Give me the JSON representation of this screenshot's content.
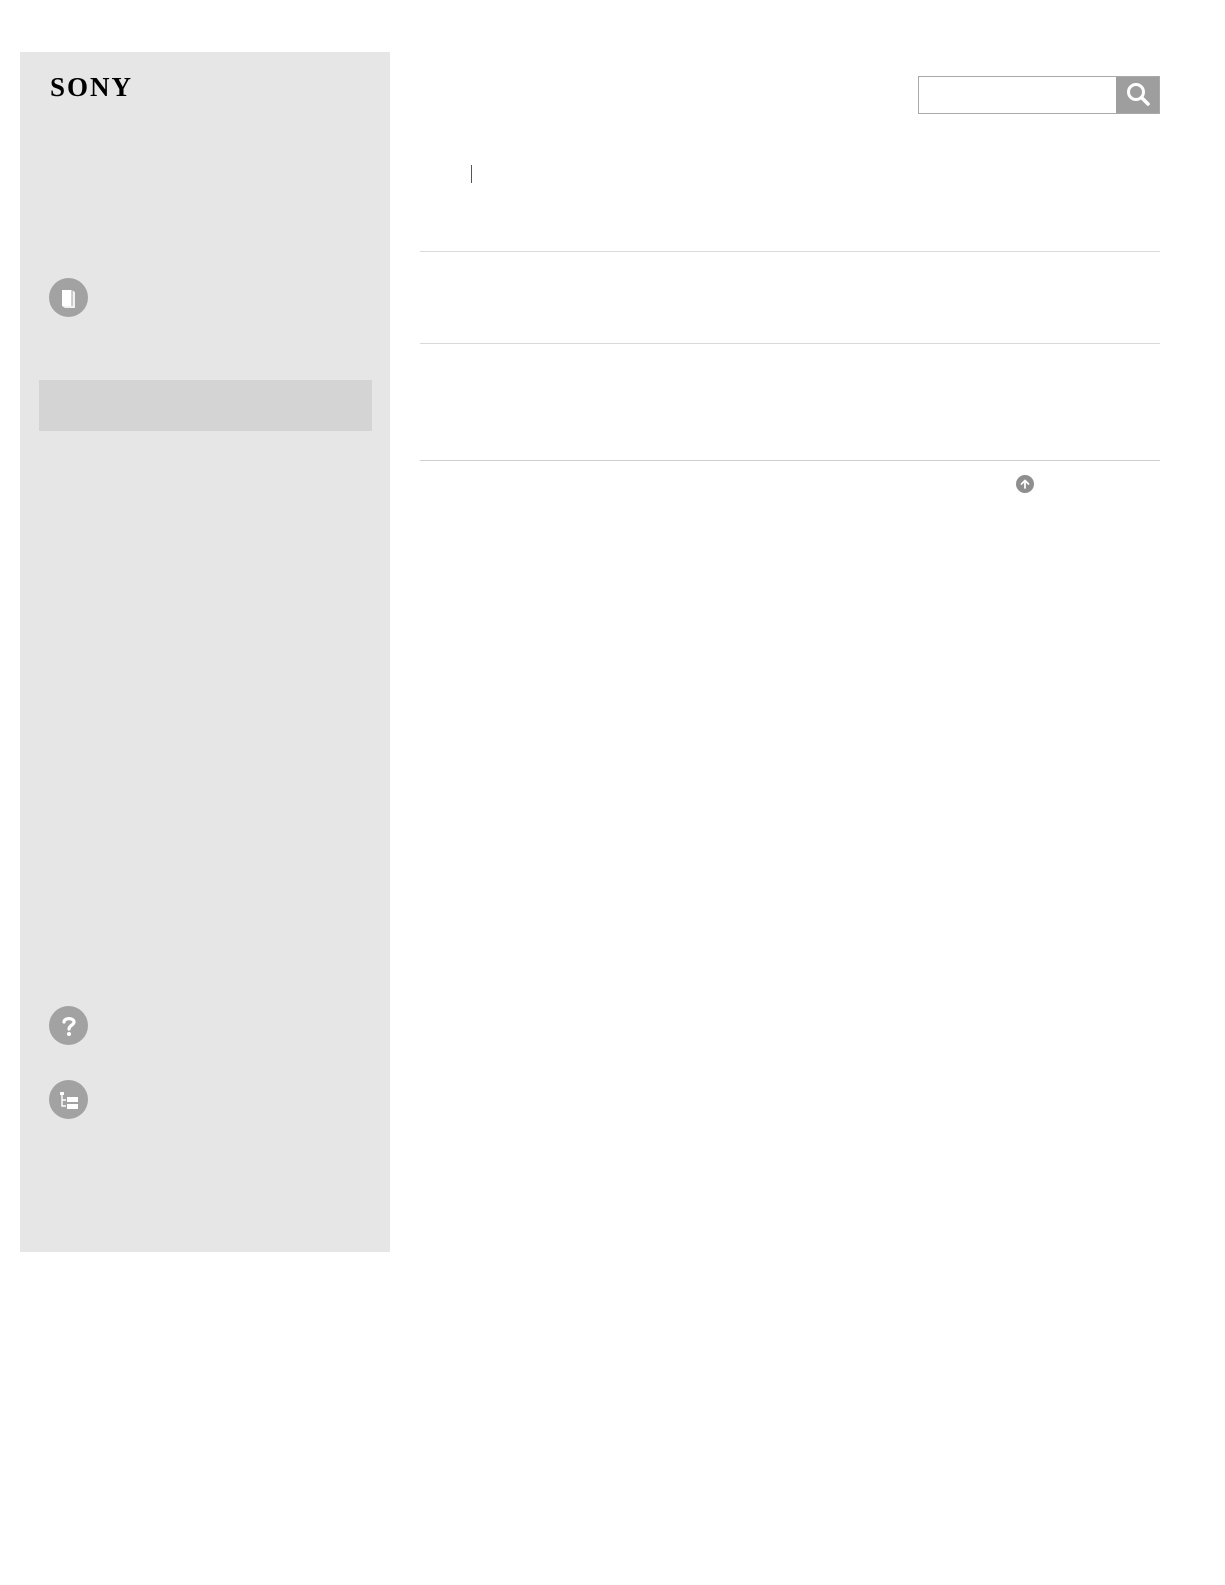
{
  "sidebar": {
    "logo_text": "SONY",
    "nav_icons": [
      "book-icon",
      "question-icon",
      "tree-icon"
    ]
  },
  "search": {
    "value": "",
    "placeholder": "",
    "button_icon": "search-icon"
  },
  "back_to_top_icon": "arrow-up-icon",
  "colors": {
    "sidebar_bg": "#e6e6e6",
    "selected_bg": "#d4d4d4",
    "icon_bg": "#a2a2a2",
    "search_button_bg": "#9e9e9e"
  }
}
